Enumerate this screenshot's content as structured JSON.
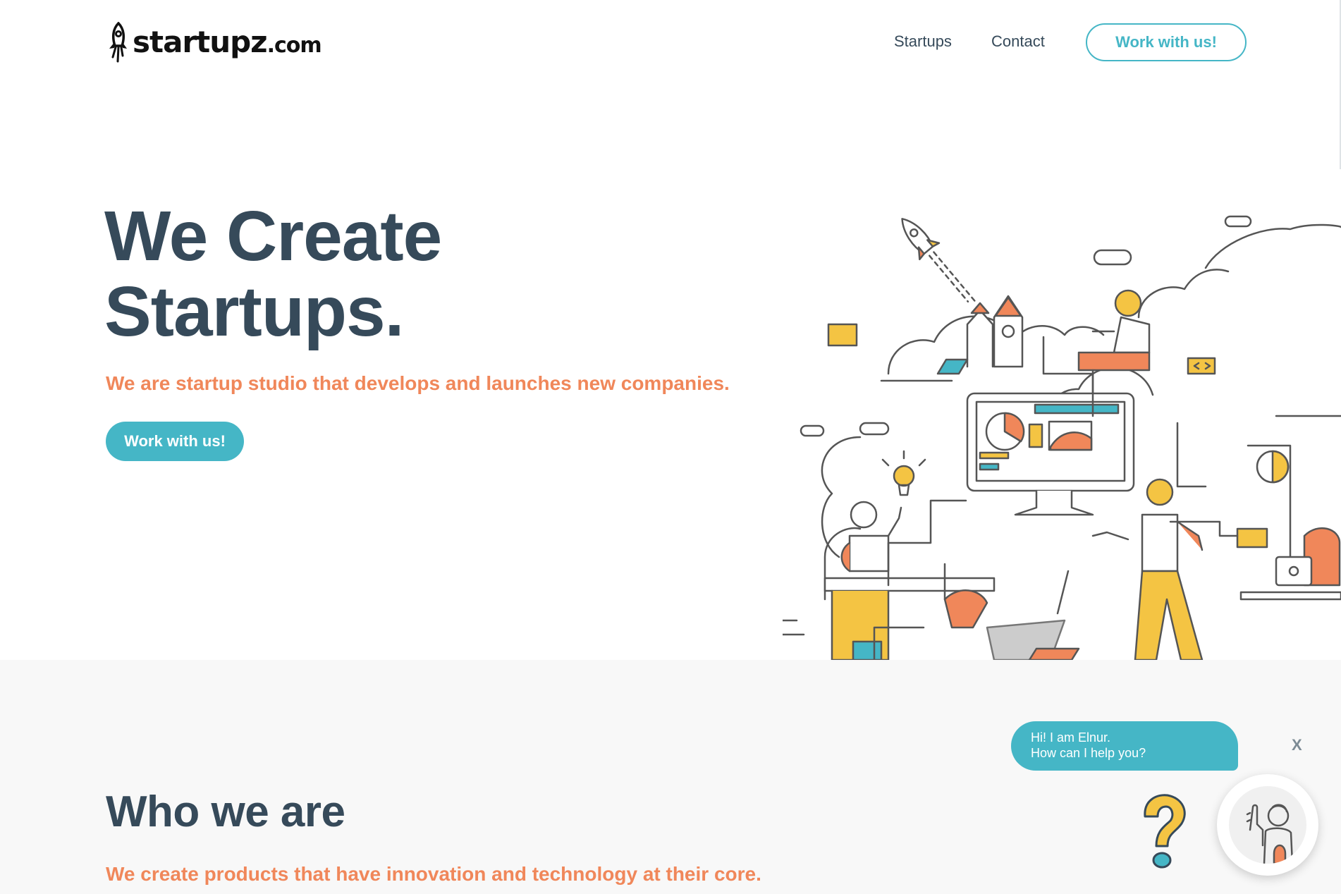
{
  "header": {
    "logo_text": "startupz",
    "logo_suffix": ".com",
    "nav": [
      "Startups",
      "Contact"
    ],
    "cta_label": "Work with us!"
  },
  "hero": {
    "title_line1": "We Create",
    "title_line2": "Startups.",
    "subtitle": "We are startup studio that develops and launches new companies.",
    "cta_label": "Work with us!"
  },
  "who": {
    "title": "Who we are",
    "subtitle": "We create products that have innovation and technology at their core."
  },
  "chat": {
    "line1": "Hi! I am Elnur.",
    "line2": "How can I help you?",
    "close_label": "X"
  },
  "colors": {
    "primary_text": "#364a5a",
    "accent_teal": "#45b6c6",
    "accent_orange": "#f0875a",
    "accent_yellow": "#f4c443",
    "section_bg": "#f8f8f8"
  },
  "icons": [
    "rocket-logo-icon",
    "question-mark-icon",
    "chat-avatar-icon"
  ]
}
